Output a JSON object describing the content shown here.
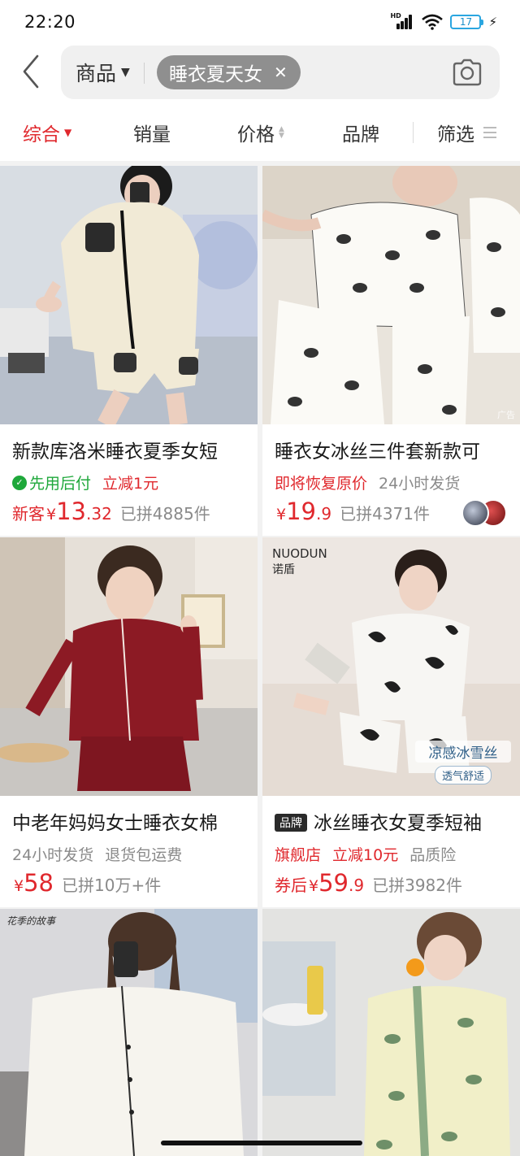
{
  "status_bar": {
    "time": "22:20",
    "network": "HD",
    "battery": "17",
    "icons": [
      "signal-icon",
      "wifi-icon",
      "battery-icon",
      "charging-icon"
    ]
  },
  "search": {
    "scope_label": "商品",
    "keyword": "睡衣夏天女",
    "icons": [
      "back-icon",
      "caret-down-icon",
      "close-icon",
      "camera-icon"
    ]
  },
  "sort_bar": {
    "items": [
      {
        "label": "综合",
        "active": true
      },
      {
        "label": "销量"
      },
      {
        "label": "价格"
      },
      {
        "label": "品牌"
      },
      {
        "label": "筛选"
      }
    ],
    "colors": {
      "active": "#e0282d",
      "inactive": "#333333"
    }
  },
  "products": [
    {
      "title": "新款库洛米睡衣夏季女短",
      "tags": [
        {
          "text": "先用后付",
          "style": "green"
        },
        {
          "text": "立减1元",
          "style": "red"
        }
      ],
      "price_prefix": "新客",
      "yen": "¥",
      "price_int": "13",
      "price_dec": ".32",
      "sold": "已拼4885件"
    },
    {
      "title": "睡衣女冰丝三件套新款可",
      "tags": [
        {
          "text": "即将恢复原价",
          "style": "red"
        },
        {
          "text": "24小时发货",
          "style": "gray"
        }
      ],
      "price_prefix": "",
      "yen": "¥",
      "price_int": "19",
      "price_dec": ".9",
      "sold": "已拼4371件",
      "ad_label": "广告"
    },
    {
      "title": "中老年妈妈女士睡衣女棉",
      "tags": [
        {
          "text": "24小时发货",
          "style": "gray"
        },
        {
          "text": "退货包运费",
          "style": "gray"
        }
      ],
      "price_prefix": "",
      "yen": "¥",
      "price_int": "58",
      "price_dec": "",
      "sold": "已拼10万+件"
    },
    {
      "brand_tag": "品牌",
      "title": "冰丝睡衣女夏季短袖",
      "tags": [
        {
          "text": "旗舰店",
          "style": "red"
        },
        {
          "text": "立减10元",
          "style": "red"
        },
        {
          "text": "品质险",
          "style": "gray"
        }
      ],
      "price_prefix": "券后",
      "yen": "¥",
      "price_int": "59",
      "price_dec": ".9",
      "sold": "已拼3982件",
      "photo_logo": "NUODUN",
      "photo_logo_zh": "诺盾",
      "photo_badge_1": "凉感冰雪丝",
      "photo_badge_2": "透气舒适"
    },
    {
      "photo_caption": "花季的故事"
    },
    {}
  ]
}
